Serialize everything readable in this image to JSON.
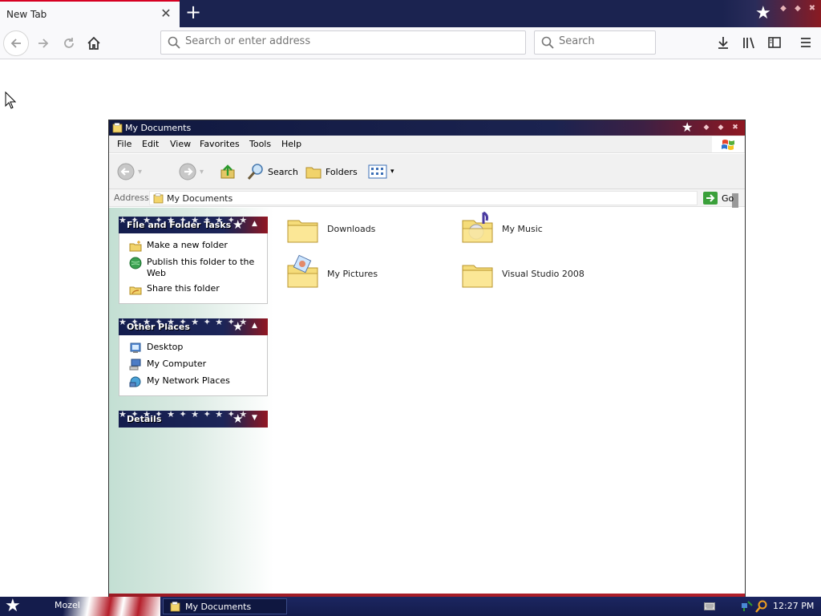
{
  "browser": {
    "tab_title": "New Tab",
    "url_placeholder": "Search or enter address",
    "search_placeholder": "Search"
  },
  "explorer": {
    "title": "My Documents",
    "menu": [
      "File",
      "Edit",
      "View",
      "Favorites",
      "Tools",
      "Help"
    ],
    "toolbar": {
      "search_label": "Search",
      "folders_label": "Folders"
    },
    "address": {
      "label": "Address",
      "value": "My Documents",
      "go_label": "Go"
    },
    "panels": {
      "file_tasks": {
        "title": "File and Folder Tasks",
        "items": [
          "Make a new folder",
          "Publish this folder to the Web",
          "Share this folder"
        ]
      },
      "other_places": {
        "title": "Other Places",
        "items": [
          "Desktop",
          "My Computer",
          "My Network Places"
        ]
      },
      "details": {
        "title": "Details"
      }
    },
    "files": [
      "Downloads",
      "My Music",
      "My Pictures",
      "Visual Studio 2008"
    ]
  },
  "taskbar": {
    "start_text": "Mozel",
    "window_button": "My Documents",
    "clock": "12:27 PM"
  },
  "colors": {
    "flag_blue": "#1b2350",
    "flag_red": "#8f1721",
    "firefox_accent": "#d70022"
  }
}
